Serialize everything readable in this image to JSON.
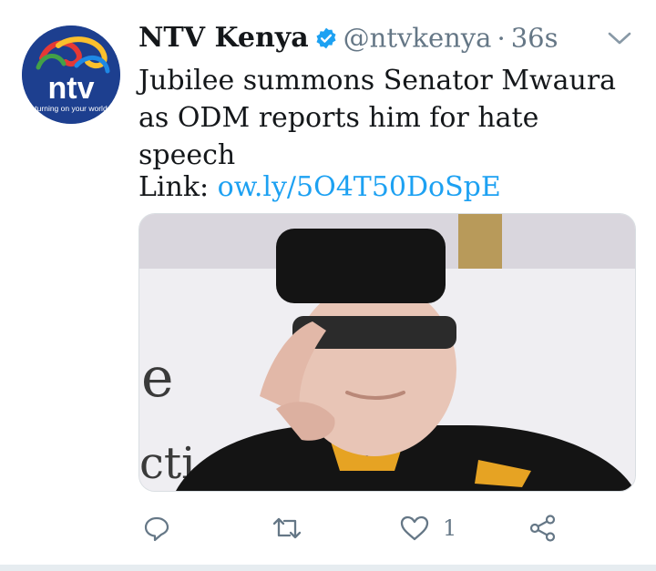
{
  "tweet": {
    "author_name": "NTV Kenya",
    "handle": "@ntvkenya",
    "separator": "·",
    "timestamp": "36s",
    "text": "Jubilee summons Senator Mwaura as ODM reports him for hate speech",
    "link_prefix": "Link: ",
    "link_text": "ow.ly/5O4T50DoSpE",
    "avatar": {
      "logo_text": "ntv",
      "tagline": "turning on your world"
    },
    "photo": {
      "banner_fragment_1": "e",
      "banner_fragment_2": "cti"
    },
    "actions": {
      "reply_icon": "reply-icon",
      "retweet_icon": "retweet-icon",
      "like_icon": "heart-icon",
      "like_count": "1",
      "share_icon": "share-icon"
    },
    "colors": {
      "link": "#1da1f2",
      "verified": "#1da1f2",
      "secondary_text": "#657786",
      "avatar_bg": "#1d3f8f"
    }
  }
}
